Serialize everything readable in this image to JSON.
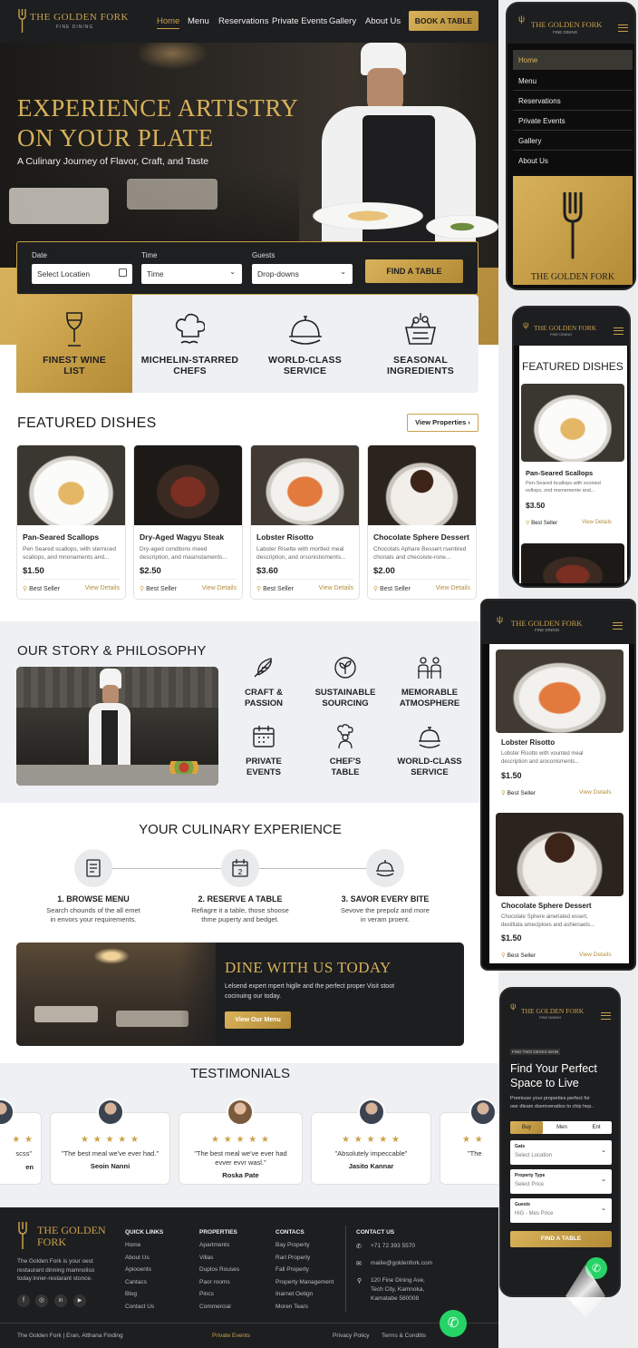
{
  "brand": {
    "name": "THE GOLDEN FORK",
    "tagline": "FINE DINING",
    "footer_name_1": "THE GOLDEN",
    "footer_name_2": "FORK"
  },
  "nav": {
    "home": "Home",
    "menu": "Menu",
    "reservations": "Reservations",
    "private_events": "Private Events",
    "gallery": "Gallery",
    "about": "About Us",
    "cta": "BOOK A TABLE"
  },
  "hero": {
    "title_1": "EXPERIENCE ARTISTRY",
    "title_2": "ON YOUR PLATE",
    "subtitle": "A Culinary Journey of Flavor, Craft, and Taste"
  },
  "booking": {
    "date_label": "Date",
    "date_value": "Select Locatien",
    "time_label": "Time",
    "time_value": "Time",
    "guests_label": "Guests",
    "guests_value": "Drop-downs",
    "button": "FIND A TABLE"
  },
  "features": [
    {
      "l1": "FINEST WINE",
      "l2": "LIST",
      "icon": "wine-glass-icon"
    },
    {
      "l1": "MICHELIN-STARRED",
      "l2": "CHEFS",
      "icon": "chef-hat-icon"
    },
    {
      "l1": "WORLD-CLASS",
      "l2": "SERVICE",
      "icon": "cloche-icon"
    },
    {
      "l1": "SEASONAL",
      "l2": "INGREDIENTS",
      "icon": "basket-icon"
    }
  ],
  "featured": {
    "title": "FEATURED DISHES",
    "button": "View Properties",
    "dishes": [
      {
        "name": "Pan-Seared Scallops",
        "desc": "Pen Seared scallops, with sterniced scallops, and mnonaments and...",
        "price": "$1.50",
        "badge": "Best Seller",
        "link": "View Details"
      },
      {
        "name": "Dry-Aged Wagyu Steak",
        "desc": "Dry-aged conditons meed description, and masinstaments...",
        "price": "$2.50",
        "badge": "Best Seller",
        "link": "View Details"
      },
      {
        "name": "Lobster Risotto",
        "desc": "Labster Risette with mortled meal description, and orsonistioments...",
        "price": "$3.60",
        "badge": "Best Seller",
        "link": "View Details"
      },
      {
        "name": "Chocolate Sphere Dessert",
        "desc": "Chocolats Aphare Bessert rsentired chonats and checoiste-rone...",
        "price": "$2.00",
        "badge": "Best Seller",
        "link": "View Details"
      }
    ]
  },
  "story": {
    "title": "OUR STORY & PHILOSOPHY",
    "items": [
      {
        "l1": "CRAFT &",
        "l2": "PASSION",
        "icon": "feather-icon"
      },
      {
        "l1": "SUSTAINABLE",
        "l2": "SOURCING",
        "icon": "leaf-icon"
      },
      {
        "l1": "MEMORABLE",
        "l2": "ATMOSPHERE",
        "icon": "people-icon"
      },
      {
        "l1": "PRIVATE",
        "l2": "EVENTS",
        "icon": "calendar-icon"
      },
      {
        "l1": "CHEF'S",
        "l2": "TABLE",
        "icon": "chef-icon"
      },
      {
        "l1": "WORLD-CLASS",
        "l2": "SERVICE",
        "icon": "cloche-icon"
      }
    ]
  },
  "experience": {
    "title": "YOUR CULINARY EXPERIENCE",
    "steps": [
      {
        "title": "1. BROWSE MENU",
        "l1": "Search chounds of the all emet",
        "l2": "in envors your requirements."
      },
      {
        "title": "2. RESERVE A TABLE",
        "l1": "Refiagre it a table, those shoose",
        "l2": "thme puperty and bedget."
      },
      {
        "title": "3. SAVOR EVERY BITE",
        "l1": "Sevove the prepolz and more",
        "l2": "in veram proent."
      }
    ]
  },
  "dine": {
    "title": "DINE WITH US TODAY",
    "l1": "Lelsend expert mpert higlle and the perfect proper Visit stoot",
    "l2": "cocinuing our today.",
    "button": "View Our Menu"
  },
  "testimonials": {
    "title": "TESTIMONIALS",
    "stars": "★ ★ ★ ★ ★",
    "stars_partial": "★ ★",
    "items": [
      {
        "quote": "\"The best meal we've ever had.\"",
        "name": "Seoin Nanni"
      },
      {
        "quote1": "\"The best meal we've ever had",
        "quote2": "evver evvr wasl.\"",
        "name": "Roska Pate"
      },
      {
        "quote": "\"Absolutely impeccable\"",
        "name": "Jasito Kannar"
      }
    ],
    "edge_left_1": "scss\"",
    "edge_left_2": "en",
    "edge_right": "\"The"
  },
  "footer": {
    "desc1": "The Golden Fork is your oest",
    "desc2": "restaurant dinning mamnoliso",
    "desc3": "today:inner-restarant stonce.",
    "quick": {
      "title": "QUICK LINKS",
      "links": [
        "Home",
        "About Us",
        "Apiooents",
        "Cantacs",
        "Blog",
        "Contact Us"
      ]
    },
    "props": {
      "title": "PROPERTIES",
      "links": [
        "Apartments",
        "Villas",
        "Duplos Rouses",
        "Paor rooms",
        "Pincs",
        "Commercial"
      ]
    },
    "contact": {
      "title": "CONTACS",
      "links": [
        "Bay Property",
        "Rarl Property",
        "Fall Property",
        "Property Management",
        "Inarnet Oetign",
        "Moren Tears"
      ]
    },
    "info": {
      "title": "CONTACT US",
      "phone": "+71 72 393 5570",
      "email": "mailie@goldenfork.com",
      "addr1": "120 Fine Dining Ave,",
      "addr2": "Tech City, Kamnoka,",
      "addr3": "Kamatabe 580008"
    },
    "bottom": {
      "left": "The Golden Fork",
      "sep": "|",
      "left2": "Eran, Atthana Finding",
      "mid": "Private Events",
      "privacy": "Privacy Policy",
      "terms": "Terms & Conditis"
    }
  },
  "mobile1": {
    "items": [
      "Home",
      "Menu",
      "Reservations",
      "Private Events",
      "Gallery",
      "About Us"
    ],
    "brand": "THE GOLDEN FORK"
  },
  "mobile2": {
    "title": "FEATURED DISHES",
    "dish": "Pan-Seared Scallops",
    "desc1": "Pen-Seared bcallops with sconied",
    "desc2": "ovllops, ond msmemente and...",
    "price": "$3.50",
    "badge": "Best Seller",
    "link": "View Details"
  },
  "mobile3": {
    "d1": {
      "name": "Lobster Risotto",
      "desc1": "Lobster Risotto with vounted meal",
      "desc2": "description and aroconisments...",
      "price": "$1.50",
      "badge": "Best Seller",
      "link": "View Details"
    },
    "d2": {
      "name": "Chocolate Sphere Dessert",
      "desc1": "Chocolate Sphere aineriated essert,",
      "desc2": "dexiitlata ameciploes and ashienaets...",
      "price": "$1.50",
      "badge": "Best Seller",
      "link": "View Details"
    }
  },
  "mobile4": {
    "kicker": "FIND TWO DESKS MAIN",
    "title1": "Find Your Perfect",
    "title2": "Space to Live",
    "desc1": "Premiuse your properties perfect for",
    "desc2": "owr dleam dsemvenatios to chip hep..",
    "tabs": [
      "Buy",
      "Men",
      "Ent"
    ],
    "f1_label": "Gats",
    "f1_value": "Select Location",
    "f2_label": "Property Type",
    "f2_value": "Select Price",
    "f3_label": "Guests",
    "f3_value": "HiG - Mes Price",
    "button": "FIND A TABLE"
  },
  "colors": {
    "gold": "#c9a24b",
    "dark": "#1d1e20",
    "whatsapp": "#25d366"
  }
}
